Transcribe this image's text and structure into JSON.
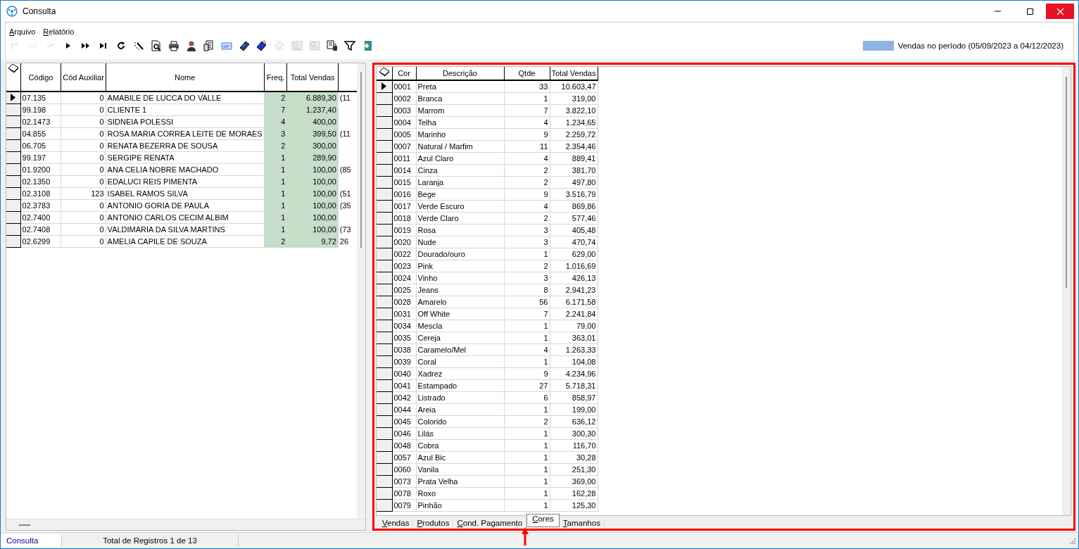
{
  "window": {
    "title": "Consulta"
  },
  "menu": [
    {
      "label": "Arquivo"
    },
    {
      "label": "Relatório"
    }
  ],
  "toolbar": [
    {
      "disabled": true
    },
    {
      "disabled": true
    },
    {
      "disabled": true
    },
    {
      "disabled": false
    },
    {
      "disabled": false
    },
    {
      "disabled": false
    },
    {
      "disabled": false
    },
    {
      "disabled": false
    },
    {
      "disabled": false
    },
    {
      "disabled": false
    },
    {
      "disabled": false
    },
    {
      "disabled": false
    },
    {
      "disabled": false
    },
    {
      "disabled": false
    },
    {
      "disabled": false
    },
    {
      "disabled": true
    },
    {
      "disabled": true
    },
    {
      "disabled": true
    },
    {
      "disabled": false
    },
    {
      "disabled": false
    },
    {
      "disabled": false
    }
  ],
  "legend": {
    "label": "Vendas no período (05/09/2023 a 04/12/2023)"
  },
  "customers_grid": {
    "columns": [
      "Código",
      "Cód Auxiliar",
      "Nome",
      "Freq.",
      "Total Vendas"
    ],
    "rows": [
      {
        "selected": true,
        "cells": [
          "07.135",
          "0",
          "AMABILE DE LUCCA DO VALLE",
          "2",
          "6.889,30",
          "(11"
        ]
      },
      {
        "selected": false,
        "cells": [
          "99.198",
          "0",
          "CLIENTE 1",
          "7",
          "1.237,40"
        ]
      },
      {
        "selected": false,
        "cells": [
          "02.1473",
          "0",
          "SIDNEIA POLESSI",
          "4",
          "400,00"
        ]
      },
      {
        "selected": false,
        "cells": [
          "04.855",
          "0",
          "ROSA MARIA CORREA LEITE DE MORAES",
          "3",
          "399,50",
          "(11"
        ]
      },
      {
        "selected": false,
        "cells": [
          "06.705",
          "0",
          "RENATA  BEZERRA DE SOUSA",
          "2",
          "300,00"
        ]
      },
      {
        "selected": false,
        "cells": [
          "99.197",
          "0",
          "SERGIPE RENATA",
          "1",
          "289,90"
        ]
      },
      {
        "selected": false,
        "cells": [
          "01.9200",
          "0",
          "ANA CELIA NOBRE MACHADO",
          "1",
          "100,00",
          "(85"
        ]
      },
      {
        "selected": false,
        "cells": [
          "02.1350",
          "0",
          "EDALUCI REIS PIMENTA",
          "1",
          "100,00"
        ]
      },
      {
        "selected": false,
        "cells": [
          "02.3108",
          "123",
          "ISABEL RAMOS SILVA",
          "1",
          "100,00",
          "(51"
        ]
      },
      {
        "selected": false,
        "cells": [
          "02.3783",
          "0",
          "ANTONIO GORIA DE PAULA",
          "1",
          "100,00",
          "(35"
        ]
      },
      {
        "selected": false,
        "cells": [
          "02.7400",
          "0",
          "ANTONIO CARLOS CECIM ALBIM",
          "1",
          "100,00"
        ]
      },
      {
        "selected": false,
        "cells": [
          "02.7408",
          "0",
          "VALDIMARIA DA SILVA MARTINS",
          "1",
          "100,00",
          "(73"
        ]
      },
      {
        "selected": false,
        "cells": [
          "02.6299",
          "0",
          "AMELIA CAPILE DE SOUZA",
          "2",
          "9,72",
          "26"
        ]
      }
    ]
  },
  "colors_grid": {
    "columns": [
      "Cor",
      "Descrição",
      "Qtde",
      "Total Vendas"
    ],
    "rows": [
      {
        "selected": true,
        "cells": [
          "0001",
          "Preta",
          "33",
          "10.603,47"
        ]
      },
      {
        "selected": false,
        "cells": [
          "0002",
          "Branca",
          "1",
          "319,00"
        ]
      },
      {
        "selected": false,
        "cells": [
          "0003",
          "Marrom",
          "7",
          "3.822,10"
        ]
      },
      {
        "selected": false,
        "cells": [
          "0004",
          "Telha",
          "4",
          "1.234,65"
        ]
      },
      {
        "selected": false,
        "cells": [
          "0005",
          "Marinho",
          "9",
          "2.259,72"
        ]
      },
      {
        "selected": false,
        "cells": [
          "0007",
          "Natural / Marfim",
          "11",
          "2.354,46"
        ]
      },
      {
        "selected": false,
        "cells": [
          "0011",
          "Azul Claro",
          "4",
          "889,41"
        ]
      },
      {
        "selected": false,
        "cells": [
          "0014",
          "Cinza",
          "2",
          "381,70"
        ]
      },
      {
        "selected": false,
        "cells": [
          "0015",
          "Laranja",
          "2",
          "497,80"
        ]
      },
      {
        "selected": false,
        "cells": [
          "0016",
          "Bege",
          "9",
          "3.516,79"
        ]
      },
      {
        "selected": false,
        "cells": [
          "0017",
          "Verde Escuro",
          "4",
          "869,86"
        ]
      },
      {
        "selected": false,
        "cells": [
          "0018",
          "Verde Claro",
          "2",
          "577,46"
        ]
      },
      {
        "selected": false,
        "cells": [
          "0019",
          "Rosa",
          "3",
          "405,48"
        ]
      },
      {
        "selected": false,
        "cells": [
          "0020",
          "Nude",
          "3",
          "470,74"
        ]
      },
      {
        "selected": false,
        "cells": [
          "0022",
          "Dourado/ouro",
          "1",
          "629,00"
        ]
      },
      {
        "selected": false,
        "cells": [
          "0023",
          "Pink",
          "2",
          "1.016,69"
        ]
      },
      {
        "selected": false,
        "cells": [
          "0024",
          "Vinho",
          "3",
          "426,13"
        ]
      },
      {
        "selected": false,
        "cells": [
          "0025",
          "Jeans",
          "8",
          "2.941,23"
        ]
      },
      {
        "selected": false,
        "cells": [
          "0028",
          "Amarelo",
          "56",
          "6.171,58"
        ]
      },
      {
        "selected": false,
        "cells": [
          "0031",
          "Off White",
          "7",
          "2.241,84"
        ]
      },
      {
        "selected": false,
        "cells": [
          "0034",
          "Mescla",
          "1",
          "79,00"
        ]
      },
      {
        "selected": false,
        "cells": [
          "0035",
          "Cereja",
          "1",
          "363,01"
        ]
      },
      {
        "selected": false,
        "cells": [
          "0038",
          "Caramelo/Mel",
          "4",
          "1.263,33"
        ]
      },
      {
        "selected": false,
        "cells": [
          "0039",
          "Coral",
          "1",
          "104,08"
        ]
      },
      {
        "selected": false,
        "cells": [
          "0040",
          "Xadrez",
          "9",
          "4.234,96"
        ]
      },
      {
        "selected": false,
        "cells": [
          "0041",
          "Estampado",
          "27",
          "5.718,31"
        ]
      },
      {
        "selected": false,
        "cells": [
          "0042",
          "Listrado",
          "6",
          "858,97"
        ]
      },
      {
        "selected": false,
        "cells": [
          "0044",
          "Areia",
          "1",
          "199,00"
        ]
      },
      {
        "selected": false,
        "cells": [
          "0045",
          "Colorido",
          "2",
          "636,12"
        ]
      },
      {
        "selected": false,
        "cells": [
          "0046",
          "Lilás",
          "1",
          "300,30"
        ]
      },
      {
        "selected": false,
        "cells": [
          "0048",
          "Cobra",
          "1",
          "116,70"
        ]
      },
      {
        "selected": false,
        "cells": [
          "0057",
          "Azul Bic",
          "1",
          "30,28"
        ]
      },
      {
        "selected": false,
        "cells": [
          "0060",
          "Vanila",
          "1",
          "251,30"
        ]
      },
      {
        "selected": false,
        "cells": [
          "0073",
          "Prata Velha",
          "1",
          "369,00"
        ]
      },
      {
        "selected": false,
        "cells": [
          "0078",
          "Roxo",
          "1",
          "162,28"
        ]
      },
      {
        "selected": false,
        "cells": [
          "0079",
          "Pinhão",
          "1",
          "125,30"
        ]
      }
    ]
  },
  "tabs": [
    {
      "label": "Vendas",
      "selected": false
    },
    {
      "label": "Produtos",
      "selected": false
    },
    {
      "label": "Cond. Pagamento",
      "selected": false
    },
    {
      "label": "Cores",
      "selected": true
    },
    {
      "label": "Tamanhos",
      "selected": false
    }
  ],
  "status_bar": [
    "Consulta",
    "Total de Registros 1 de 13"
  ]
}
